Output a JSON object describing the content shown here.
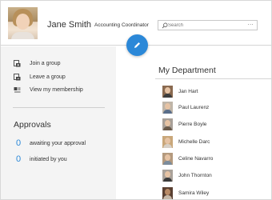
{
  "header": {
    "user_name": "Jane Smith",
    "user_title": "Accounting Coordinator",
    "search_placeholder": "Search",
    "search_more": "...",
    "fab_icon": "pencil-icon"
  },
  "actions": [
    {
      "label": "Join a group",
      "icon": "join-group-icon"
    },
    {
      "label": "Leave a group",
      "icon": "leave-group-icon"
    },
    {
      "label": "View my membership",
      "icon": "membership-icon"
    }
  ],
  "approvals": {
    "title": "Approvals",
    "items": [
      {
        "count": "0",
        "label": "awaiting your approval"
      },
      {
        "count": "0",
        "label": "initiated by you"
      }
    ]
  },
  "department": {
    "title": "My Department",
    "members": [
      {
        "name": "Jan Hart"
      },
      {
        "name": "Paul Laurenz"
      },
      {
        "name": "Pierre Boyle"
      },
      {
        "name": "Michelle Darc"
      },
      {
        "name": "Celine Navarro"
      },
      {
        "name": "John Thornton"
      },
      {
        "name": "Samira Wiley"
      }
    ]
  },
  "colors": {
    "accent": "#2b88d8",
    "panel_bg": "#f4f4f4"
  }
}
